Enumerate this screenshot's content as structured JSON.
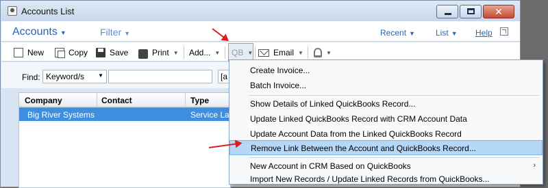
{
  "window": {
    "title": "Accounts List"
  },
  "nav": {
    "accounts": "Accounts",
    "filter": "Filter",
    "recent": "Recent",
    "list": "List",
    "help": "Help"
  },
  "toolbar": {
    "new": "New",
    "copy": "Copy",
    "save": "Save",
    "print": "Print",
    "add": "Add...",
    "qb": "QB",
    "email": "Email"
  },
  "find": {
    "label": "Find:",
    "mode": "Keyword/s",
    "value": "",
    "extra": "[a"
  },
  "grid": {
    "columns": [
      "Company",
      "Contact",
      "Type"
    ],
    "rows": [
      {
        "company": "Big River Systems",
        "contact": "",
        "type": "Service Lab"
      }
    ]
  },
  "menu": {
    "items": [
      "Create Invoice...",
      "Batch Invoice...",
      "Show Details of Linked QuickBooks Record...",
      "Update Linked QuickBooks Record with CRM Account Data",
      "Update Account Data from the Linked QuickBooks Record",
      "Remove Link Between the Account and QuickBooks Record...",
      "New Account in CRM Based on QuickBooks",
      "Import New Records / Update Linked Records from QuickBooks..."
    ],
    "highlighted_index": 5
  },
  "colors": {
    "accent": "#2a64b6",
    "selection": "#3f8fe0",
    "menu_highlight": "#b5d7f8",
    "annotation_arrow": "#e01b1b"
  }
}
